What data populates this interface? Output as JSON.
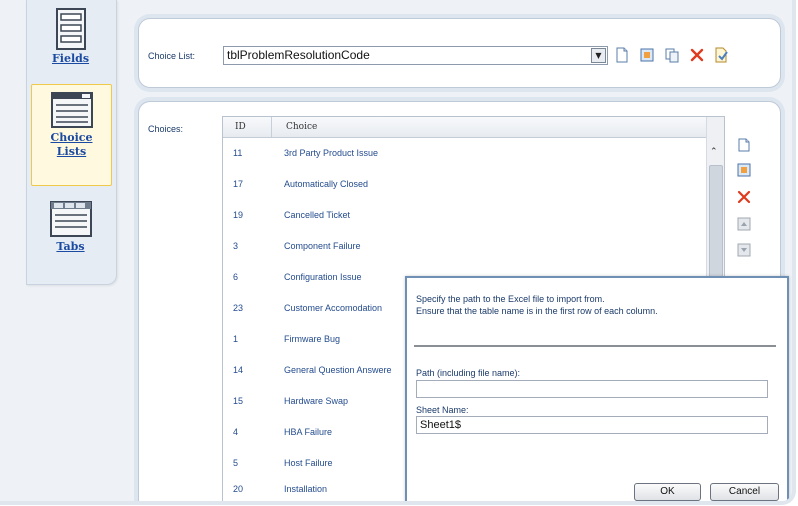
{
  "nav": {
    "fields_label": "Fields",
    "choice_lists_label_line1": "Choice",
    "choice_lists_label_line2": "Lists",
    "tabs_label": "Tabs"
  },
  "choice_list": {
    "label": "Choice List:",
    "selected_value": "tblProblemResolutionCode"
  },
  "choices": {
    "label": "Choices:",
    "headers": [
      "ID",
      "Choice"
    ],
    "rows": [
      {
        "id": "11",
        "choice": "3rd Party Product Issue"
      },
      {
        "id": "17",
        "choice": "Automatically Closed"
      },
      {
        "id": "19",
        "choice": "Cancelled Ticket"
      },
      {
        "id": "3",
        "choice": "Component Failure"
      },
      {
        "id": "6",
        "choice": "Configuration Issue"
      },
      {
        "id": "23",
        "choice": "Customer Accomodation"
      },
      {
        "id": "1",
        "choice": "Firmware Bug"
      },
      {
        "id": "14",
        "choice": "General Question Answere"
      },
      {
        "id": "15",
        "choice": "Hardware Swap"
      },
      {
        "id": "4",
        "choice": "HBA Failure"
      },
      {
        "id": "5",
        "choice": "Host Failure"
      },
      {
        "id": "20",
        "choice": "Installation"
      }
    ]
  },
  "import_dialog": {
    "instruction_line1": "Specify the path to the Excel file to import from.",
    "instruction_line2": "Ensure that the table name is in the first row of each column.",
    "path_label": "Path (including file name):",
    "path_value": "",
    "sheet_label": "Sheet Name:",
    "sheet_value": "Sheet1$",
    "ok_label": "OK",
    "cancel_label": "Cancel"
  },
  "colors": {
    "link": "#1a4aa2",
    "selected_nav_bg": "#fff9df",
    "delete_red": "#e03a1e",
    "dialog_border": "#6f8fb5"
  }
}
